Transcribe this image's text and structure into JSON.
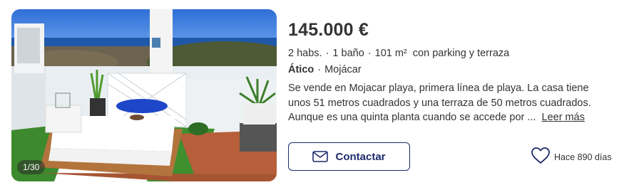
{
  "listing": {
    "price": "145.000 €",
    "features": [
      "2 habs.",
      "1 baño",
      "101 m²",
      "con parking y terraza"
    ],
    "separator": "·",
    "property_type": "Ático",
    "location": "Mojácar",
    "description": "Se vende en Mojacar playa, primera línea de playa. La casa tiene unos 51 metros cuadrados y una terraza de 50 metros cuadrados. Aunque es una quinta planta cuando se accede por ...",
    "read_more": "Leer más",
    "photo_counter": "1/30",
    "contact_label": "Contactar",
    "published": "Hace 890 días"
  },
  "icons": {
    "contact": "mail-icon",
    "favorite": "heart-icon"
  },
  "colors": {
    "accent": "#1e2a6b",
    "text": "#333333"
  }
}
